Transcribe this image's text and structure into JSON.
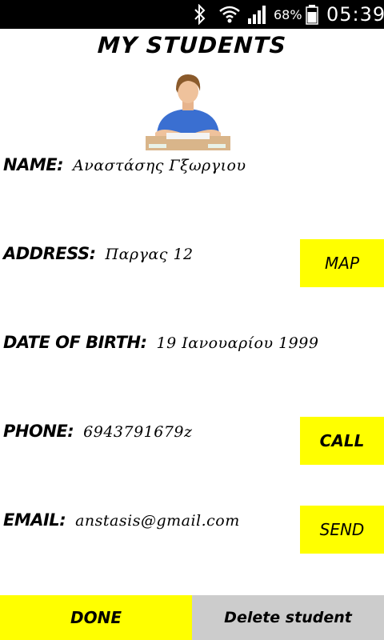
{
  "status_bar": {
    "battery_pct": "68%",
    "time": "05:39",
    "icons": [
      "bluetooth-icon",
      "wifi-icon",
      "signal-icon",
      "battery-icon"
    ]
  },
  "header": {
    "title": "MY STUDENTS"
  },
  "student": {
    "photo": "student-photo",
    "fields": {
      "name": {
        "label": "NAME:",
        "value": "Αναστάσης Γξωργιου"
      },
      "address": {
        "label": "ADDRESS:",
        "value": "Παργας 12"
      },
      "dob": {
        "label": "DATE OF BIRTH:",
        "value": "19 Ιανουαρίου 1999"
      },
      "phone": {
        "label": "PHONE:",
        "value": "6943791679z"
      },
      "email": {
        "label": "EMAIL:",
        "value": "anstasis@gmail.com"
      }
    }
  },
  "actions": {
    "map": "MAP",
    "call": "CALL",
    "send": "SEND"
  },
  "bottom_bar": {
    "done": "DONE",
    "delete": "Delete student"
  },
  "colors": {
    "accent": "#ffff00",
    "secondary_button": "#cccccc",
    "status_bar": "#000000"
  }
}
